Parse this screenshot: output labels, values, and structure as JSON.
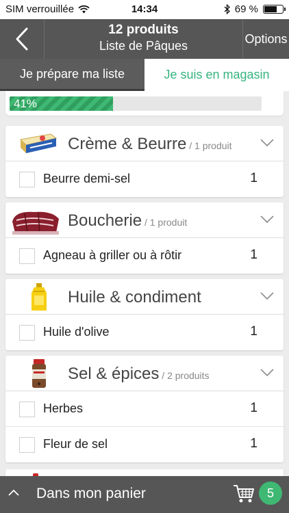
{
  "status_bar": {
    "carrier": "SIM verrouillée",
    "time": "14:34",
    "battery_text": "69 %",
    "battery_level": 0.69,
    "icons": [
      "wifi-icon",
      "bluetooth-icon",
      "battery-icon"
    ]
  },
  "nav": {
    "title": "12 produits",
    "subtitle": "Liste de Pâques",
    "options_label": "Options",
    "back_icon": "chevron-left-icon"
  },
  "tabs": {
    "prepare_label": "Je prépare ma liste",
    "store_label": "Je suis en magasin"
  },
  "progress": {
    "percent": 41,
    "label": "41%"
  },
  "categories": [
    {
      "name": "Crème & Beurre",
      "count": " / 1 produit",
      "image_icon": "butter-icon",
      "items": [
        {
          "name": "Beurre demi-sel",
          "qty": "1"
        }
      ]
    },
    {
      "name": "Boucherie",
      "count": " / 1 produit",
      "image_icon": "meat-icon",
      "items": [
        {
          "name": "Agneau à griller ou à rôtir",
          "qty": "1"
        }
      ]
    },
    {
      "name": "Huile & condiment",
      "count": "",
      "image_icon": "oil-bottle-icon",
      "items": [
        {
          "name": "Huile d'olive",
          "qty": "1"
        }
      ]
    },
    {
      "name": "Sel & épices",
      "count": " / 2 produits",
      "image_icon": "spice-jar-icon",
      "items": [
        {
          "name": "Herbes",
          "qty": "1"
        },
        {
          "name": "Fleur de sel",
          "qty": "1"
        }
      ]
    }
  ],
  "bottom_bar": {
    "label": "Dans mon panier",
    "badge": "5",
    "cart_icon": "cart-icon"
  },
  "colors": {
    "accent_green": "#3fb873",
    "bar_gray": "#565656"
  }
}
